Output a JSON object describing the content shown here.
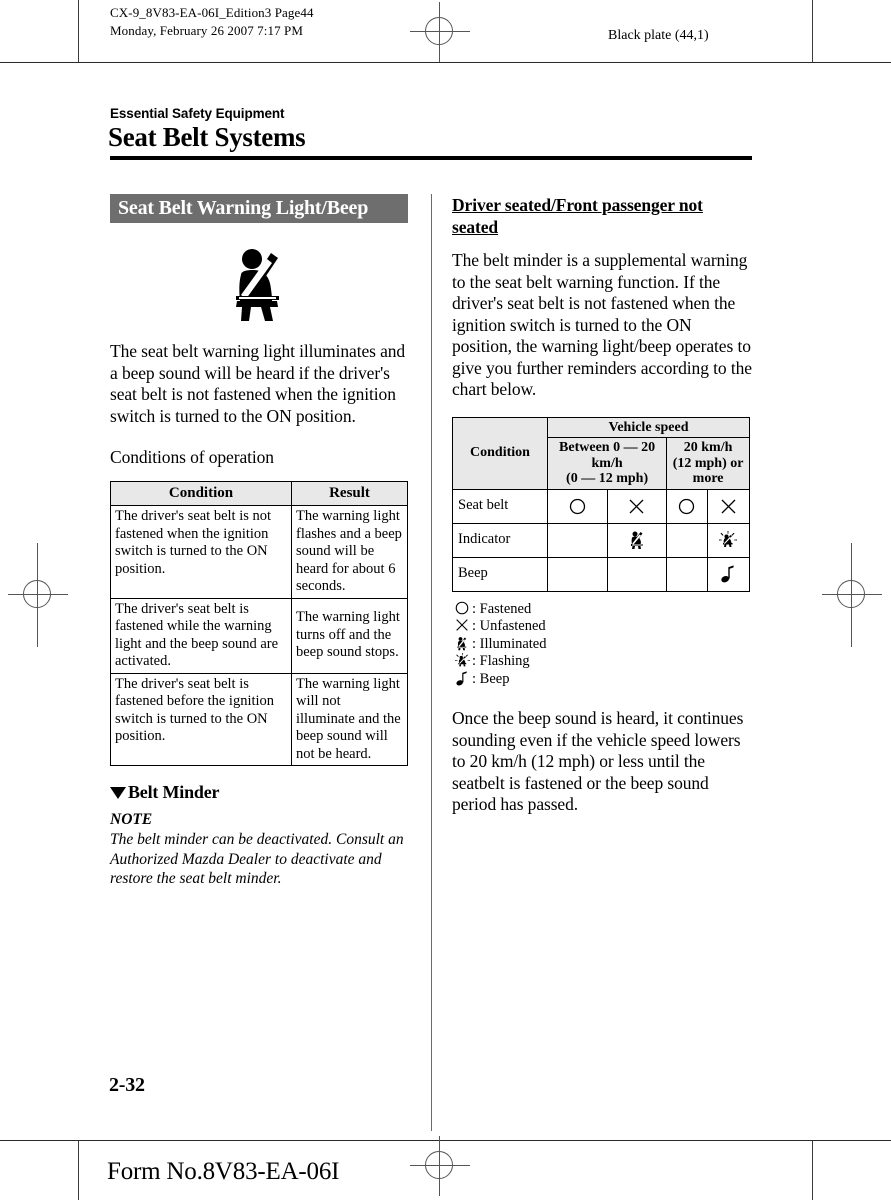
{
  "print_marks": {
    "slug_line1": "CX-9_8V83-EA-06I_Edition3 Page44",
    "slug_line2": "Monday, February 26 2007 7:17 PM",
    "plate_label": "Black plate (44,1)"
  },
  "header": {
    "section_label": "Essential Safety Equipment",
    "chapter_title": "Seat Belt Systems"
  },
  "left_column": {
    "banner_title": "Seat Belt Warning Light/Beep",
    "icon_name": "seat-belt-warning-icon",
    "intro_paragraph": "The seat belt warning light illuminates and a beep sound will be heard if the driver's seat belt is not fastened when the ignition switch is turned to the ON position.",
    "table_caption": "Conditions of operation",
    "conditions_table": {
      "headers": [
        "Condition",
        "Result"
      ],
      "rows": [
        {
          "condition": "The driver's seat belt is not fastened when the ignition switch is turned to the ON position.",
          "result": "The warning light flashes and a beep sound will be heard for about 6 seconds."
        },
        {
          "condition": "The driver's seat belt is fastened while the warning light and the beep sound are activated.",
          "result": "The warning light turns off and the beep sound stops."
        },
        {
          "condition": "The driver's seat belt is fastened before the ignition switch is turned to the ON position.",
          "result": "The warning light will not illuminate and the beep sound will not be heard."
        }
      ]
    },
    "belt_minder_heading": "Belt Minder",
    "note_label": "NOTE",
    "note_text": "The belt minder can be deactivated. Consult an Authorized Mazda Dealer to deactivate and restore the seat belt minder."
  },
  "right_column": {
    "subheading": "Driver seated/Front passenger not seated",
    "paragraph_1": "The belt minder is a supplemental warning to the seat belt warning function. If the driver's seat belt is not fastened when the ignition switch is turned to the ON position, the warning light/beep operates to give you further reminders according to the chart below.",
    "speed_table": {
      "corner_header": "Condition",
      "group_header": "Vehicle speed",
      "speed_headers": [
        "Between 0 — 20 km/h\n(0 — 12 mph)",
        "20 km/h\n(12 mph) or more"
      ],
      "speed_header_1_line1": "Between 0 — 20",
      "speed_header_1_line2": "km/h",
      "speed_header_1_line3": "(0 — 12 mph)",
      "speed_header_2_line1": "20 km/h",
      "speed_header_2_line2": "(12 mph) or",
      "speed_header_2_line3": "more",
      "rows": [
        {
          "label": "Seat belt",
          "cells": [
            "fastened",
            "unfastened",
            "fastened",
            "unfastened"
          ]
        },
        {
          "label": "Indicator",
          "cells": [
            "",
            "illuminated",
            "",
            "flashing"
          ]
        },
        {
          "label": "Beep",
          "cells": [
            "",
            "",
            "",
            "beep"
          ]
        }
      ]
    },
    "legend": [
      {
        "symbol": "circle",
        "text": ": Fastened"
      },
      {
        "symbol": "cross",
        "text": ": Unfastened"
      },
      {
        "symbol": "belt-illuminated",
        "text": ": Illuminated"
      },
      {
        "symbol": "belt-flashing",
        "text": ": Flashing"
      },
      {
        "symbol": "music-note",
        "text": ": Beep"
      }
    ],
    "paragraph_2": "Once the beep sound is heard, it continues sounding even if the vehicle speed lowers to 20 km/h (12 mph) or less until the seatbelt is fastened or the beep sound period has passed."
  },
  "footer": {
    "page_number": "2-32",
    "form_number": "Form No.8V83-EA-06I"
  },
  "colors": {
    "banner_bg": "#6e6e6e",
    "banner_text": "#ffffff",
    "table_header_bg": "#e8e8e8",
    "rule": "#000000"
  }
}
